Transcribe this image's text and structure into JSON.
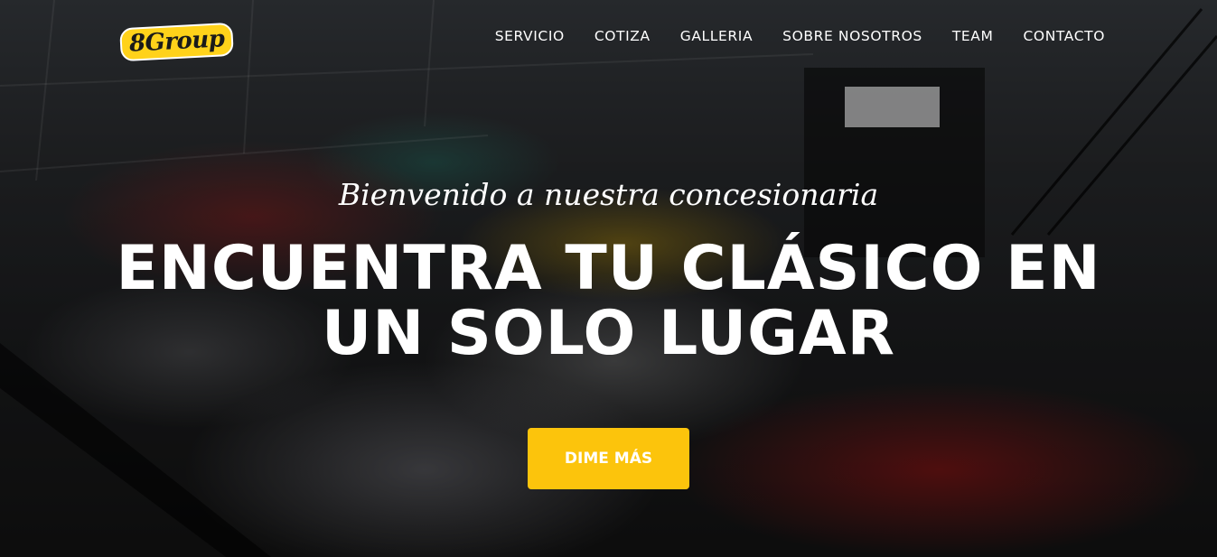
{
  "brand": {
    "logo_text": "8Group"
  },
  "nav": {
    "items": [
      {
        "label": "SERVICIO"
      },
      {
        "label": "COTIZA"
      },
      {
        "label": "GALLERIA"
      },
      {
        "label": "SOBRE NOSOTROS"
      },
      {
        "label": "TEAM"
      },
      {
        "label": "CONTACTO"
      }
    ]
  },
  "hero": {
    "subtitle": "Bienvenido a nuestra concesionaria",
    "headline_line1": "ENCUENTRA TU CLÁSICO EN",
    "headline_line2": "UN SOLO LUGAR",
    "cta_label": "DIME MÁS",
    "cta_color": "#fcc40c"
  }
}
